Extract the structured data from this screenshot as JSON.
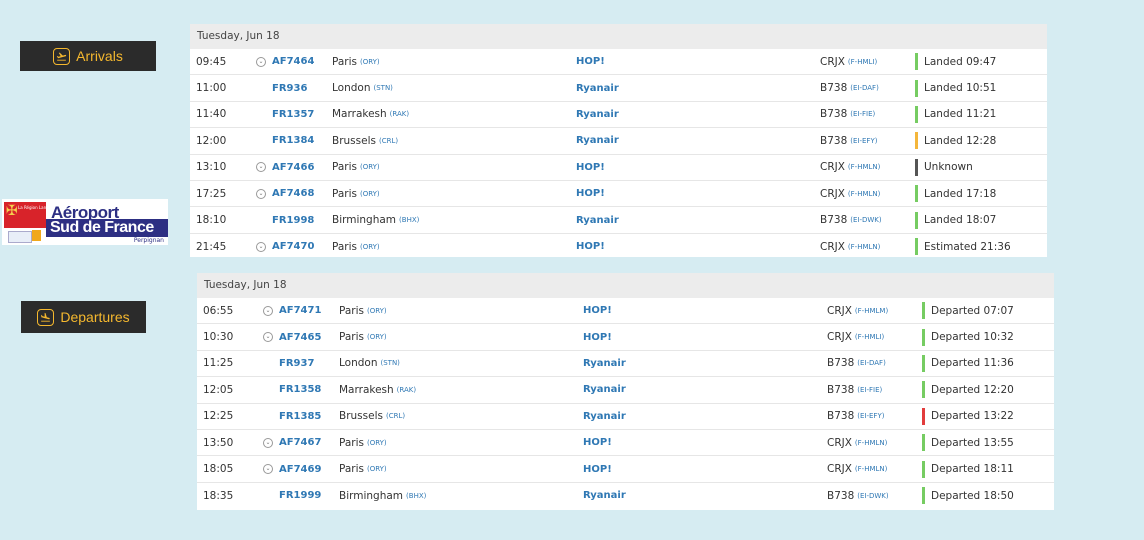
{
  "colors": {
    "green": "#76cc62",
    "amber": "#f4b63b",
    "gray": "#555555",
    "red": "#e23c3c",
    "link": "#2f78b4"
  },
  "arrivals_tag": {
    "label": "Arrivals",
    "icon": "plane-arrival-icon"
  },
  "departures_tag": {
    "label": "Departures",
    "icon": "plane-departure-icon"
  },
  "logo": {
    "line1": "Aéroport",
    "line2": "Sud de France",
    "line3": "Perpignan",
    "region": "La Région Languedoc Roussillon"
  },
  "arrivals": {
    "date": "Tuesday, Jun 18",
    "rows": [
      {
        "time": "09:45",
        "codeshare": true,
        "flight": "AF7464",
        "city": "Paris",
        "code": "(ORY)",
        "airline": "HOP!",
        "aircraft": "CRJX",
        "reg": "(F-HMLI)",
        "status": "Landed 09:47",
        "status_color": "green"
      },
      {
        "time": "11:00",
        "codeshare": false,
        "flight": "FR936",
        "city": "London",
        "code": "(STN)",
        "airline": "Ryanair",
        "aircraft": "B738",
        "reg": "(EI-DAF)",
        "status": "Landed 10:51",
        "status_color": "green"
      },
      {
        "time": "11:40",
        "codeshare": false,
        "flight": "FR1357",
        "city": "Marrakesh",
        "code": "(RAK)",
        "airline": "Ryanair",
        "aircraft": "B738",
        "reg": "(EI-FIE)",
        "status": "Landed 11:21",
        "status_color": "green"
      },
      {
        "time": "12:00",
        "codeshare": false,
        "flight": "FR1384",
        "city": "Brussels",
        "code": "(CRL)",
        "airline": "Ryanair",
        "aircraft": "B738",
        "reg": "(EI-EFY)",
        "status": "Landed 12:28",
        "status_color": "amber"
      },
      {
        "time": "13:10",
        "codeshare": true,
        "flight": "AF7466",
        "city": "Paris",
        "code": "(ORY)",
        "airline": "HOP!",
        "aircraft": "CRJX",
        "reg": "(F-HMLN)",
        "status": "Unknown",
        "status_color": "gray"
      },
      {
        "time": "17:25",
        "codeshare": true,
        "flight": "AF7468",
        "city": "Paris",
        "code": "(ORY)",
        "airline": "HOP!",
        "aircraft": "CRJX",
        "reg": "(F-HMLN)",
        "status": "Landed 17:18",
        "status_color": "green"
      },
      {
        "time": "18:10",
        "codeshare": false,
        "flight": "FR1998",
        "city": "Birmingham",
        "code": "(BHX)",
        "airline": "Ryanair",
        "aircraft": "B738",
        "reg": "(EI-DWK)",
        "status": "Landed 18:07",
        "status_color": "green"
      },
      {
        "time": "21:45",
        "codeshare": true,
        "flight": "AF7470",
        "city": "Paris",
        "code": "(ORY)",
        "airline": "HOP!",
        "aircraft": "CRJX",
        "reg": "(F-HMLN)",
        "status": "Estimated 21:36",
        "status_color": "green"
      }
    ]
  },
  "departures": {
    "date": "Tuesday, Jun 18",
    "rows": [
      {
        "time": "06:55",
        "codeshare": true,
        "flight": "AF7471",
        "city": "Paris",
        "code": "(ORY)",
        "airline": "HOP!",
        "aircraft": "CRJX",
        "reg": "(F-HMLM)",
        "status": "Departed 07:07",
        "status_color": "green"
      },
      {
        "time": "10:30",
        "codeshare": true,
        "flight": "AF7465",
        "city": "Paris",
        "code": "(ORY)",
        "airline": "HOP!",
        "aircraft": "CRJX",
        "reg": "(F-HMLI)",
        "status": "Departed 10:32",
        "status_color": "green"
      },
      {
        "time": "11:25",
        "codeshare": false,
        "flight": "FR937",
        "city": "London",
        "code": "(STN)",
        "airline": "Ryanair",
        "aircraft": "B738",
        "reg": "(EI-DAF)",
        "status": "Departed 11:36",
        "status_color": "green"
      },
      {
        "time": "12:05",
        "codeshare": false,
        "flight": "FR1358",
        "city": "Marrakesh",
        "code": "(RAK)",
        "airline": "Ryanair",
        "aircraft": "B738",
        "reg": "(EI-FIE)",
        "status": "Departed 12:20",
        "status_color": "green"
      },
      {
        "time": "12:25",
        "codeshare": false,
        "flight": "FR1385",
        "city": "Brussels",
        "code": "(CRL)",
        "airline": "Ryanair",
        "aircraft": "B738",
        "reg": "(EI-EFY)",
        "status": "Departed 13:22",
        "status_color": "red"
      },
      {
        "time": "13:50",
        "codeshare": true,
        "flight": "AF7467",
        "city": "Paris",
        "code": "(ORY)",
        "airline": "HOP!",
        "aircraft": "CRJX",
        "reg": "(F-HMLN)",
        "status": "Departed 13:55",
        "status_color": "green"
      },
      {
        "time": "18:05",
        "codeshare": true,
        "flight": "AF7469",
        "city": "Paris",
        "code": "(ORY)",
        "airline": "HOP!",
        "aircraft": "CRJX",
        "reg": "(F-HMLN)",
        "status": "Departed 18:11",
        "status_color": "green"
      },
      {
        "time": "18:35",
        "codeshare": false,
        "flight": "FR1999",
        "city": "Birmingham",
        "code": "(BHX)",
        "airline": "Ryanair",
        "aircraft": "B738",
        "reg": "(EI-DWK)",
        "status": "Departed 18:50",
        "status_color": "green"
      }
    ]
  }
}
